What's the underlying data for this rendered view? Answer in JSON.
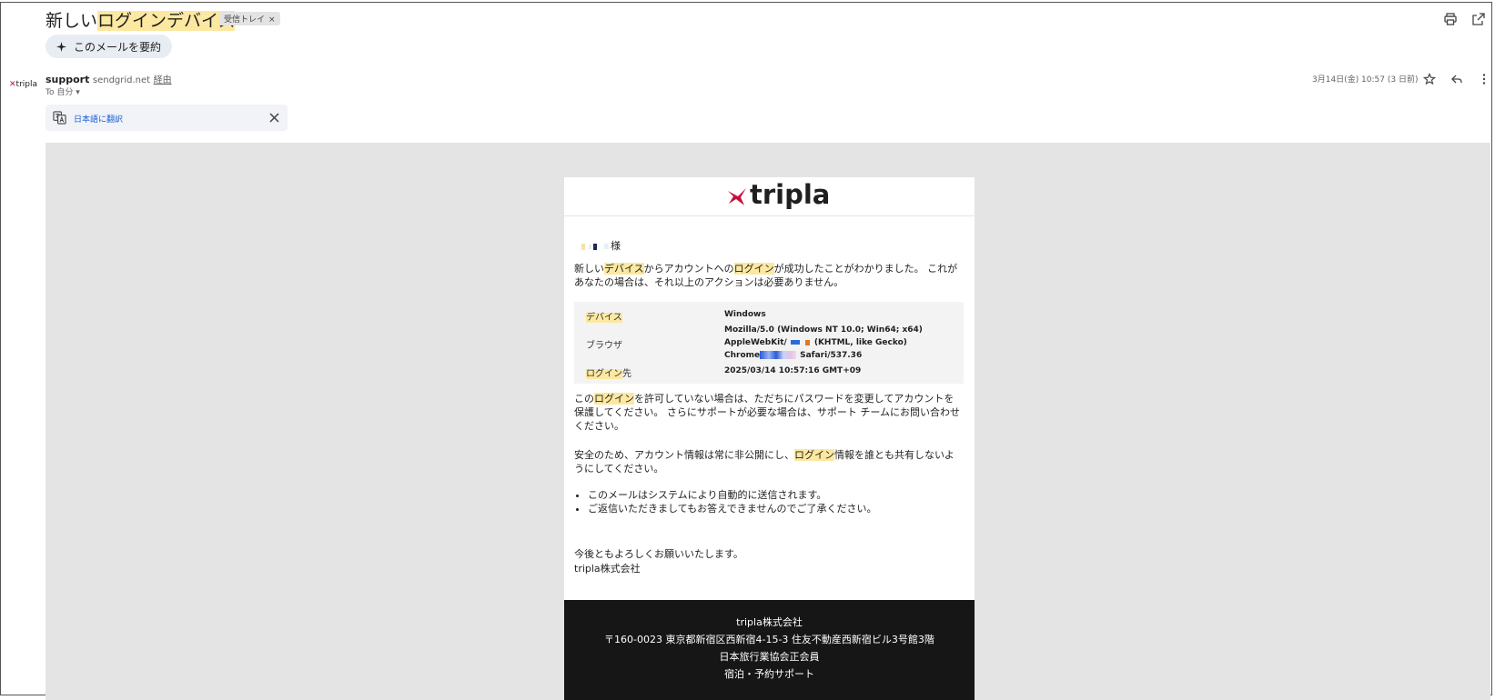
{
  "subject": {
    "before": "新しい",
    "highlight": "ログインデバイス"
  },
  "inbox_badge": {
    "label": "受信トレイ",
    "remove": "×"
  },
  "summary_button": {
    "label": "このメールを要約"
  },
  "sender": {
    "logo_text": "tripla",
    "name": "support",
    "domain": "sendgrid.net",
    "via": "経由",
    "to": "To 自分"
  },
  "date": "3月14日(金) 10:57 (3 日前)",
  "translate_bar": {
    "label": "日本語に翻訳"
  },
  "email": {
    "logo": "tripla",
    "greeting_suffix": "様",
    "p1": {
      "a": "新しい",
      "b": "デバイス",
      "c": "からアカウントへの",
      "d": "ログイン",
      "e": "が成功したことがわかりました。 これがあなたの場合は、それ以上のアクションは必要ありません。"
    },
    "info": {
      "device_label": "デバイス",
      "device_value": "Windows",
      "browser_label": "ブラウザ",
      "browser_line1": "Mozilla/5.0 (Windows NT 10.0; Win64; x64)",
      "browser_line2a": "AppleWebKit/",
      "browser_line2b": "(KHTML, like Gecko)",
      "browser_line3a": "Chrome",
      "browser_line3b": "Safari/537.36",
      "login_label_hl": "ログイン",
      "login_label_rest": "先",
      "login_value": "2025/03/14 10:57:16 GMT+09"
    },
    "p2": {
      "a": "この",
      "b": "ログイン",
      "c": "を許可していない場合は、ただちにパスワードを変更してアカウントを保護してください。 さらにサポートが必要な場合は、サポート チームにお問い合わせください。"
    },
    "p3": {
      "a": "安全のため、アカウント情報は常に非公開にし、",
      "b": "ログイン",
      "c": "情報を誰とも共有しないようにしてください。"
    },
    "bullets": [
      "このメールはシステムにより自動的に送信されます。",
      "ご返信いただきましてもお答えできませんのでご了承ください。"
    ],
    "closing": [
      "今後ともよろしくお願いいたします。",
      "tripla株式会社"
    ]
  },
  "footer": [
    "tripla株式会社",
    "〒160-0023 東京都新宿区西新宿4-15-3 住友不動産西新宿ビル3号館3階",
    "日本旅行業協会正会員",
    "宿泊・予約サポート"
  ]
}
